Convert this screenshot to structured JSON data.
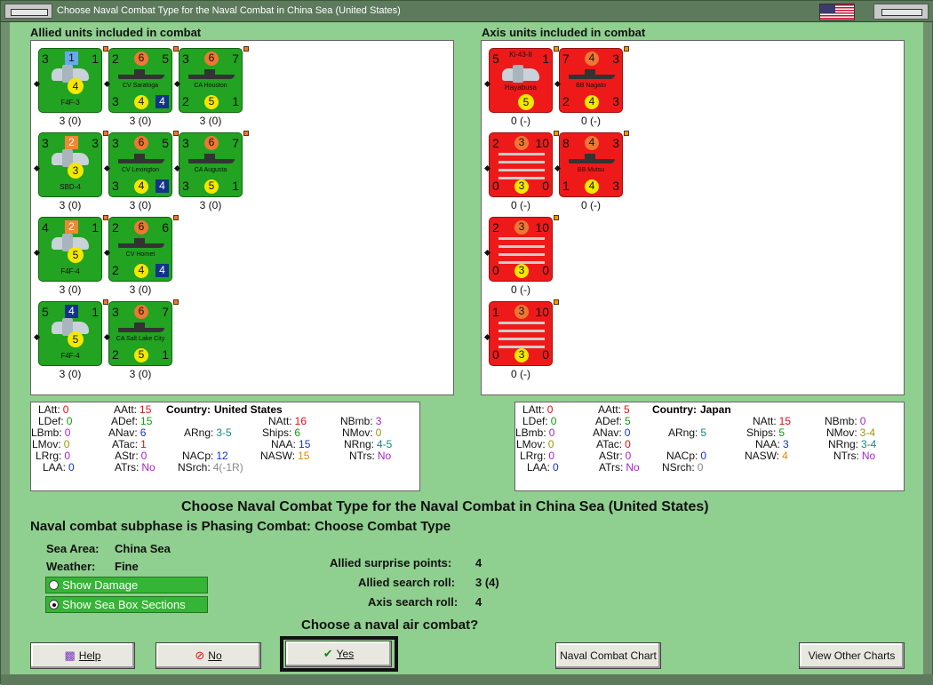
{
  "window": {
    "title": "Choose Naval Combat Type for the Naval Combat in China Sea (United States)"
  },
  "allied": {
    "header": "Allied units included in combat",
    "units": [
      {
        "kind": "air",
        "c1": "3",
        "c2": "1",
        "c3": "1",
        "c4": "4",
        "name": "F4F-3",
        "cap": "3 (0)"
      },
      {
        "kind": "ship",
        "c1": "2",
        "c2": "6",
        "c3": "5",
        "b1": "3",
        "b2": "4",
        "b3": "4",
        "name": "CV Saratoga",
        "cap": "3 (0)"
      },
      {
        "kind": "ship",
        "c1": "3",
        "c2": "6",
        "c3": "7",
        "b1": "2",
        "b2": "5",
        "b3": "1",
        "name": "CA Houston",
        "cap": "3 (0)"
      },
      {
        "kind": "air",
        "c1": "3",
        "c2": "2",
        "c3": "3",
        "c4": "3",
        "name": "SBD-4",
        "cap": "3 (0)"
      },
      {
        "kind": "ship",
        "c1": "3",
        "c2": "6",
        "c3": "5",
        "b1": "3",
        "b2": "4",
        "b3": "4",
        "name": "CV Lexington",
        "cap": "3 (0)"
      },
      {
        "kind": "ship",
        "c1": "3",
        "c2": "6",
        "c3": "7",
        "b1": "3",
        "b2": "5",
        "b3": "1",
        "name": "CA Augusta",
        "cap": "3 (0)"
      },
      {
        "kind": "air",
        "c1": "4",
        "c2": "2",
        "c3": "1",
        "c4": "5",
        "name": "F4F-4",
        "cap": "3 (0)"
      },
      {
        "kind": "ship",
        "c1": "2",
        "c2": "6",
        "c3": "6",
        "b1": "2",
        "b2": "4",
        "b3": "4",
        "name": "CV Hornet",
        "cap": "3 (0)"
      },
      {
        "kind": "air",
        "c1": "5",
        "c2": "4",
        "c3": "1",
        "c4": "5",
        "name": "F4F-4",
        "cap": "3 (0)"
      },
      {
        "kind": "ship",
        "c1": "3",
        "c2": "6",
        "c3": "7",
        "b1": "2",
        "b2": "5",
        "b3": "1",
        "name": "CA Salt Lake City",
        "cap": "3 (0)"
      }
    ]
  },
  "axis": {
    "header": "Axis units included in combat",
    "units": [
      {
        "kind": "air",
        "c1": "5",
        "c3": "1",
        "c4": "5",
        "name": "Ki-43-II",
        "name2": "Hayabusa",
        "cap": "0 (-)"
      },
      {
        "kind": "ship",
        "c1": "7",
        "c2": "4",
        "c3": "3",
        "b1": "2",
        "b2": "4",
        "b3": "3",
        "name": "BB Nagato",
        "cap": "0 (-)"
      },
      {
        "kind": "sub",
        "c1": "2",
        "c2": "3",
        "c3": "10",
        "b1": "0",
        "b2": "3",
        "b3": "0",
        "cap": "0 (-)"
      },
      {
        "kind": "ship",
        "c1": "8",
        "c2": "4",
        "c3": "3",
        "b1": "1",
        "b2": "4",
        "b3": "3",
        "name": "BB Mutsu",
        "cap": "0 (-)"
      },
      {
        "kind": "sub",
        "c1": "2",
        "c2": "3",
        "c3": "10",
        "b1": "0",
        "b2": "3",
        "b3": "0",
        "cap": "0 (-)"
      },
      {
        "kind": "sub",
        "c1": "1",
        "c2": "3",
        "c3": "10",
        "b1": "0",
        "b2": "3",
        "b3": "0",
        "cap": "0 (-)"
      }
    ]
  },
  "allied_stats": {
    "country_label": "Country:",
    "country": "United States",
    "LAtt": "0",
    "LDef": "0",
    "LBmb": "0",
    "LMov": "0",
    "LRrg": "0",
    "LAA": "0",
    "AAtt": "15",
    "ADef": "15",
    "ANav": "6",
    "ATac": "1",
    "AStr": "0",
    "ATrs": "No",
    "ARng": "3-5",
    "NACp": "12",
    "NSrch": "4(-1R)",
    "NAtt": "16",
    "Ships": "6",
    "NAA": "15",
    "NASW": "15",
    "NBmb": "3",
    "NMov": "0",
    "NRng": "4-5",
    "NTrs": "No"
  },
  "axis_stats": {
    "country_label": "Country:",
    "country": "Japan",
    "LAtt": "0",
    "LDef": "0",
    "LBmb": "0",
    "LMov": "0",
    "LRrg": "0",
    "LAA": "0",
    "AAtt": "5",
    "ADef": "5",
    "ANav": "0",
    "ATac": "0",
    "AStr": "0",
    "ATrs": "No",
    "ARng": "5",
    "NACp": "0",
    "NSrch": "0",
    "NAtt": "15",
    "Ships": "5",
    "NAA": "3",
    "NASW": "4",
    "NBmb": "0",
    "NMov": "3-4",
    "NRng": "3-4",
    "NTrs": "No"
  },
  "labels": {
    "LAtt": "LAtt:",
    "LDef": "LDef:",
    "LBmb": "LBmb:",
    "LMov": "LMov:",
    "LRrg": "LRrg:",
    "LAA": "LAA:",
    "AAtt": "AAtt:",
    "ADef": "ADef:",
    "ANav": "ANav:",
    "ATac": "ATac:",
    "AStr": "AStr:",
    "ATrs": "ATrs:",
    "ARng": "ARng:",
    "NACp": "NACp:",
    "NSrch": "NSrch:",
    "NAtt": "NAtt:",
    "Ships": "Ships:",
    "NAA": "NAA:",
    "NASW": "NASW:",
    "NBmb": "NBmb:",
    "NMov": "NMov:",
    "NRng": "NRng:",
    "NTrs": "NTrs:"
  },
  "main": {
    "title": "Choose Naval Combat Type for the Naval Combat in China Sea (United States)",
    "subphase": "Naval combat subphase is Phasing Combat: Choose Combat Type",
    "sea_area_label": "Sea Area:",
    "sea_area": "China Sea",
    "weather_label": "Weather:",
    "weather": "Fine",
    "show_damage": "Show Damage",
    "show_sea_box": "Show Sea Box Sections",
    "surprise_label": "Allied surprise points:",
    "surprise": "4",
    "allied_search_label": "Allied search roll:",
    "allied_search": "3 (4)",
    "axis_search_label": "Axis search roll:",
    "axis_search": "4",
    "question": "Choose a naval air combat?"
  },
  "buttons": {
    "help": "Help",
    "no": "No",
    "yes": "Yes",
    "naval_chart": "Naval Combat Chart",
    "view_other": "View Other Charts"
  },
  "colors": {
    "allied_unit": "#22a322",
    "axis_unit": "#ee1a1a",
    "background": "#8fcf8f"
  }
}
